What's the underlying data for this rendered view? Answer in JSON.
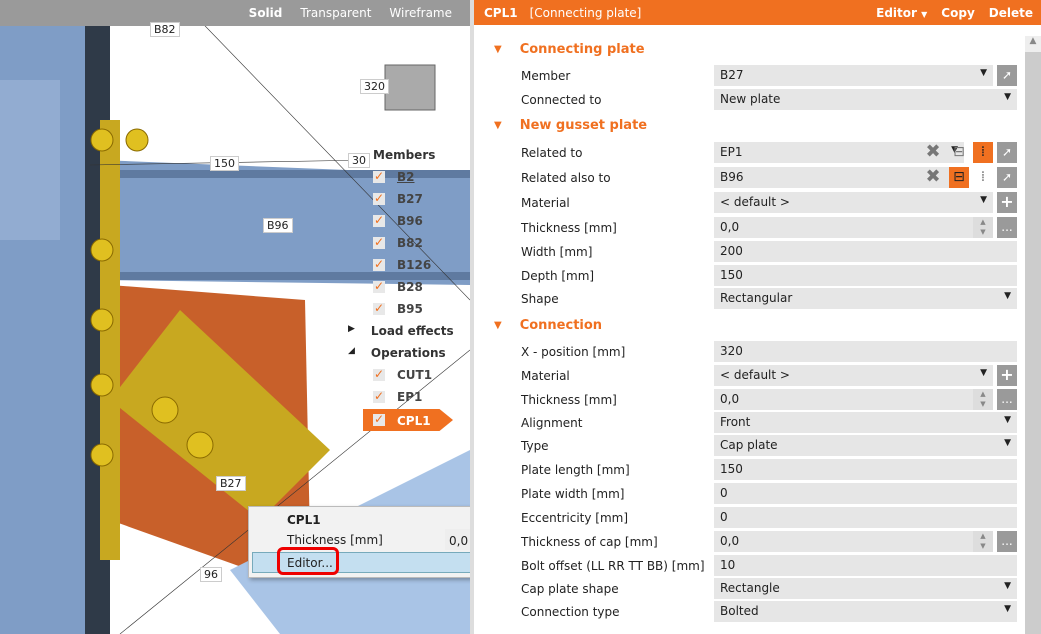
{
  "viewport": {
    "modes": [
      "Solid",
      "Transparent",
      "Wireframe"
    ],
    "active_mode": "Solid",
    "labels": [
      "B82",
      "320",
      "150",
      "30",
      "B96",
      "B27",
      "96"
    ],
    "tree": {
      "members_header": "Members",
      "members": [
        "B2",
        "B27",
        "B96",
        "B82",
        "B126",
        "B28",
        "B95"
      ],
      "load_effects": "Load effects",
      "operations_header": "Operations",
      "operations": [
        "CUT1",
        "EP1",
        "CPL1"
      ],
      "selected": "CPL1"
    },
    "popup": {
      "title": "CPL1",
      "thickness_label": "Thickness [mm]",
      "thickness_value": "0,0",
      "more": "...",
      "editor": "Editor..."
    }
  },
  "panel": {
    "title": "CPL1",
    "subtitle": "[Connecting plate]",
    "editor": "Editor",
    "copy": "Copy",
    "delete": "Delete",
    "sections": {
      "s1": "Connecting plate",
      "s2": "New gusset plate",
      "s3": "Connection"
    },
    "rows": {
      "member": {
        "label": "Member",
        "value": "B27"
      },
      "connected_to": {
        "label": "Connected to",
        "value": "New plate"
      },
      "related_to": {
        "label": "Related to",
        "value": "EP1"
      },
      "related_also_to": {
        "label": "Related also to",
        "value": "B96"
      },
      "material1": {
        "label": "Material",
        "value": "< default >"
      },
      "thickness1": {
        "label": "Thickness [mm]",
        "value": "0,0"
      },
      "width": {
        "label": "Width [mm]",
        "value": "200"
      },
      "depth": {
        "label": "Depth [mm]",
        "value": "150"
      },
      "shape": {
        "label": "Shape",
        "value": "Rectangular"
      },
      "xpos": {
        "label": "X - position [mm]",
        "value": "320"
      },
      "material2": {
        "label": "Material",
        "value": "< default >"
      },
      "thickness2": {
        "label": "Thickness [mm]",
        "value": "0,0"
      },
      "alignment": {
        "label": "Alignment",
        "value": "Front"
      },
      "type": {
        "label": "Type",
        "value": "Cap plate"
      },
      "plate_length": {
        "label": "Plate length [mm]",
        "value": "150"
      },
      "plate_width": {
        "label": "Plate width [mm]",
        "value": "0"
      },
      "eccentricity": {
        "label": "Eccentricity [mm]",
        "value": "0"
      },
      "cap_thickness": {
        "label": "Thickness of cap [mm]",
        "value": "0,0"
      },
      "offset": {
        "label": "Bolt offset (LL RR TT BB) [mm]",
        "value": "10"
      },
      "cap_shape": {
        "label": "Cap plate shape",
        "value": "Rectangle"
      },
      "conn_type": {
        "label": "Connection type",
        "value": "Bolted"
      }
    },
    "more": "..."
  },
  "colors": {
    "accent": "#f07020",
    "beam": "#7f9dc6",
    "plate": "#c8a820",
    "gusset": "#c8602a"
  }
}
